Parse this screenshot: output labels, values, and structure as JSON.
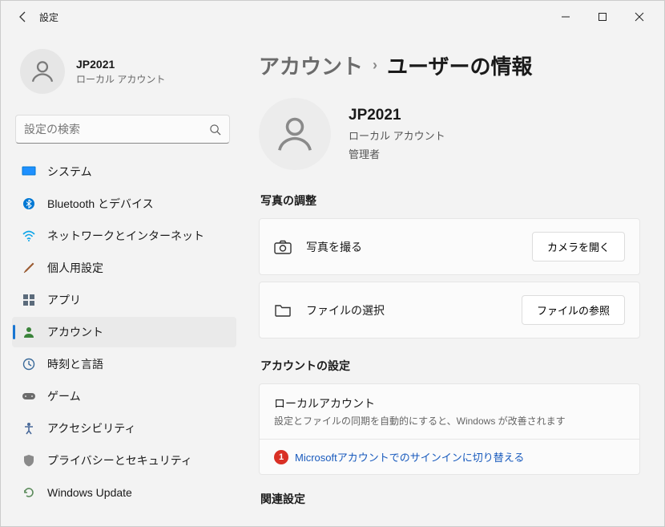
{
  "titlebar": {
    "title": "設定"
  },
  "profile": {
    "name": "JP2021",
    "sub": "ローカル アカウント"
  },
  "search": {
    "placeholder": "設定の検索"
  },
  "nav": {
    "items": [
      {
        "label": "システム"
      },
      {
        "label": "Bluetooth とデバイス"
      },
      {
        "label": "ネットワークとインターネット"
      },
      {
        "label": "個人用設定"
      },
      {
        "label": "アプリ"
      },
      {
        "label": "アカウント"
      },
      {
        "label": "時刻と言語"
      },
      {
        "label": "ゲーム"
      },
      {
        "label": "アクセシビリティ"
      },
      {
        "label": "プライバシーとセキュリティ"
      },
      {
        "label": "Windows Update"
      }
    ]
  },
  "breadcrumb": {
    "parent": "アカウント",
    "current": "ユーザーの情報"
  },
  "user": {
    "name": "JP2021",
    "line1": "ローカル アカウント",
    "line2": "管理者"
  },
  "sections": {
    "photo": {
      "label": "写真の調整",
      "takePhoto": "写真を撮る",
      "openCamera": "カメラを開く",
      "chooseFile": "ファイルの選択",
      "browseFile": "ファイルの参照"
    },
    "account": {
      "label": "アカウントの設定",
      "localTitle": "ローカルアカウント",
      "localSub": "設定とファイルの同期を自動的にすると、Windows が改善されます",
      "switchLink": "Microsoftアカウントでのサインインに切り替える",
      "badge": "1"
    },
    "related": {
      "label": "関連設定"
    }
  }
}
